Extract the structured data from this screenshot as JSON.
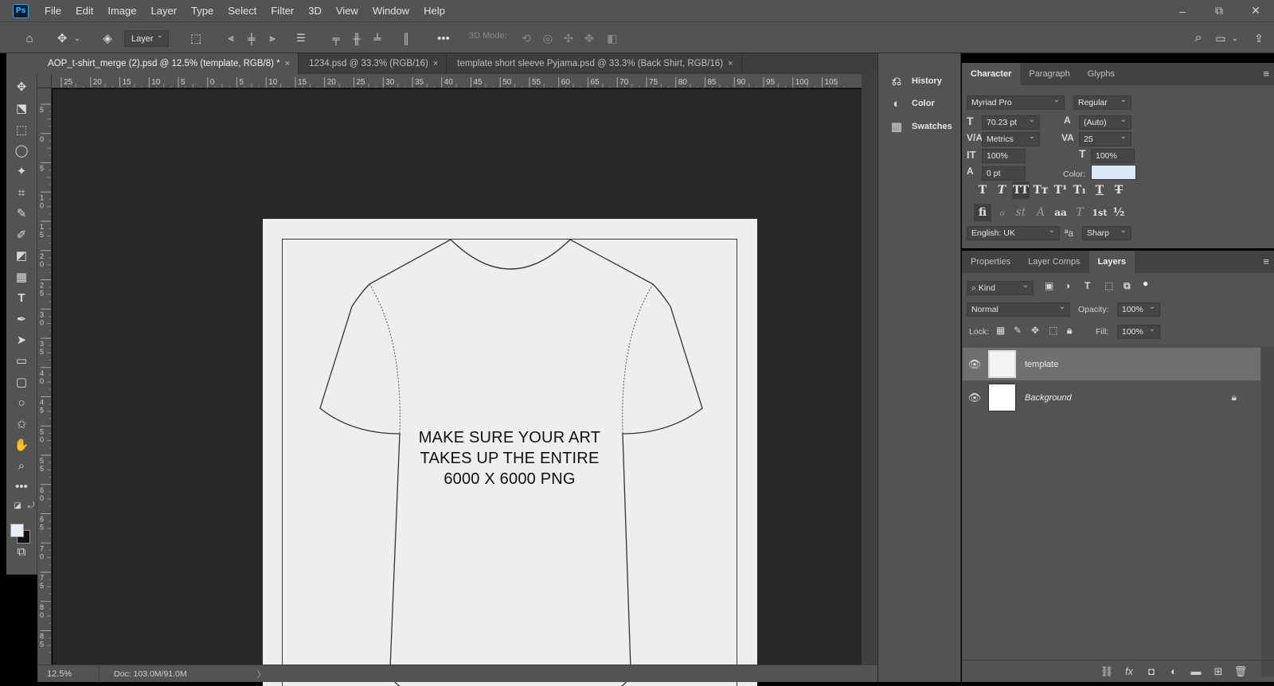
{
  "app": {
    "logo_text": "Ps",
    "menu": [
      "File",
      "Edit",
      "Image",
      "Layer",
      "Type",
      "Select",
      "Filter",
      "3D",
      "View",
      "Window",
      "Help"
    ],
    "window_controls": {
      "minimize": "–",
      "restore": "⧉",
      "close": "✕"
    }
  },
  "options_bar": {
    "layer_select": "Layer",
    "mode_3d_label": "3D Mode:"
  },
  "tabs": [
    {
      "label": "AOP_t-shirt_merge (2).psd @ 12.5% (template, RGB/8) *",
      "close": "×",
      "active": true
    },
    {
      "label": "1234.psd @ 33.3% (RGB/16)",
      "close": "×",
      "active": false
    },
    {
      "label": "template short sleeve Pyjama.psd @ 33.3% (Back Shirt, RGB/16)",
      "close": "×",
      "active": false
    }
  ],
  "rulers": {
    "horizontal": [
      "25",
      "20",
      "15",
      "10",
      "5",
      "0",
      "5",
      "10",
      "15",
      "20",
      "25",
      "30",
      "35",
      "40",
      "45",
      "50",
      "55",
      "60",
      "65",
      "70",
      "75",
      "80",
      "85",
      "90",
      "95",
      "100",
      "105"
    ],
    "vertical": [
      "5",
      "0",
      "5",
      "1 0",
      "1 5",
      "2 0",
      "2 5",
      "3 0",
      "3 5",
      "4 0",
      "4 5",
      "5 0",
      "5 5",
      "6 0",
      "6 5",
      "7 0",
      "7 5",
      "8 0",
      "8 5"
    ]
  },
  "canvas": {
    "art_text": [
      "MAKE SURE YOUR ART",
      "TAKES UP THE ENTIRE",
      "6000 X 6000 PNG"
    ]
  },
  "status": {
    "zoom": "12.5%",
    "doc": "Doc: 103.0M/91.0M",
    "arrow": "〉"
  },
  "mini_panel": {
    "items": [
      {
        "icon": "history-icon",
        "label": "History"
      },
      {
        "icon": "color-icon",
        "label": "Color"
      },
      {
        "icon": "swatches-icon",
        "label": "Swatches"
      }
    ]
  },
  "character_panel": {
    "tabs": [
      "Character",
      "Paragraph",
      "Glyphs"
    ],
    "active_tab": "Character",
    "font_family": "Myriad Pro",
    "font_style": "Regular",
    "font_size": "70.23 pt",
    "leading": "(Auto)",
    "kerning": "Metrics",
    "tracking": "25",
    "vertical_scale": "100%",
    "horizontal_scale": "100%",
    "baseline_shift": "0 pt",
    "color_label": "Color:",
    "color_value": "#dbe9fb",
    "style_buttons": [
      "T",
      "T",
      "TT",
      "Tт",
      "T¹",
      "T₁",
      "T",
      "T"
    ],
    "opentype_buttons": [
      "fi",
      "ℴ",
      "st",
      "A",
      "aa",
      "T",
      "1st",
      "½"
    ],
    "language": "English: UK",
    "aa_icon": "ªa",
    "anti_alias": "Sharp"
  },
  "layers_panel": {
    "tabs": [
      "Properties",
      "Layer Comps",
      "Layers"
    ],
    "active_tab": "Layers",
    "filter_kind": "Kind",
    "blend_mode": "Normal",
    "opacity_label": "Opacity:",
    "opacity": "100%",
    "lock_label": "Lock:",
    "fill_label": "Fill:",
    "fill": "100%",
    "layers": [
      {
        "name": "template",
        "visible": true,
        "selected": true,
        "locked": false
      },
      {
        "name": "Background",
        "visible": true,
        "selected": false,
        "locked": true
      }
    ]
  }
}
